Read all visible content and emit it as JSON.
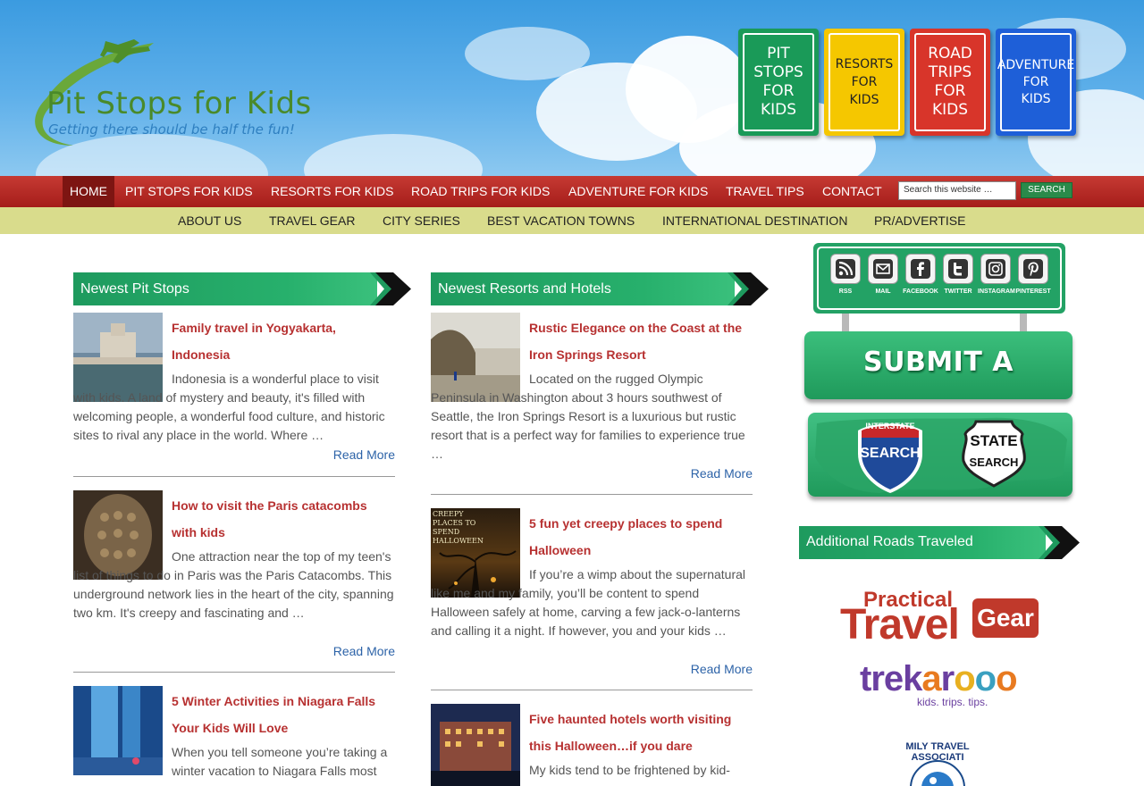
{
  "header": {
    "logo_title": "Pit Stops for Kids",
    "logo_tagline": "Getting there should be half the fun!",
    "signs": [
      {
        "label": "PIT\nSTOPS\nFOR\nKIDS",
        "bg": "#1a9a58",
        "fg": "#ffffff"
      },
      {
        "label": "RESORTS\nFOR\nKIDS",
        "bg": "#f5c700",
        "fg": "#222222"
      },
      {
        "label": "ROAD\nTRIPS\nFOR\nKIDS",
        "bg": "#d8352a",
        "fg": "#ffffff"
      },
      {
        "label": "ADVENTURE\nFOR\nKIDS",
        "bg": "#1e5fd8",
        "fg": "#ffffff"
      }
    ]
  },
  "nav_primary": {
    "items": [
      "HOME",
      "PIT STOPS FOR KIDS",
      "RESORTS FOR KIDS",
      "ROAD TRIPS FOR KIDS",
      "ADVENTURE FOR KIDS",
      "TRAVEL TIPS",
      "CONTACT"
    ],
    "search_placeholder": "Search this website …",
    "search_button": "SEARCH"
  },
  "nav_secondary": {
    "items": [
      "ABOUT US",
      "TRAVEL GEAR",
      "CITY SERIES",
      "BEST VACATION TOWNS",
      "INTERNATIONAL DESTINATION",
      "PR/ADVERTISE"
    ]
  },
  "pitstops": {
    "heading": "Newest Pit Stops",
    "posts": [
      {
        "title": "Family travel in Yogyakarta, Indonesia",
        "excerpt": "Indonesia is a wonderful place to visit with kids. A land of mystery and beauty, it's filled with welcoming people, a wonderful food culture, and historic sites to rival any place in the world. Where …",
        "more": "Read More"
      },
      {
        "title": "How to visit the Paris catacombs with kids",
        "excerpt": "One attraction near the top of my teen's list of things to do in Paris was the Paris Catacombs. This underground network lies in the heart of the city, spanning two km. It's creepy and fascinating and …",
        "more": "Read More"
      },
      {
        "title": "5 Winter Activities in Niagara Falls Your Kids Will Love",
        "excerpt": "When you tell someone you’re taking a winter vacation to Niagara Falls most",
        "more": ""
      }
    ]
  },
  "resorts": {
    "heading": "Newest Resorts and Hotels",
    "posts": [
      {
        "title": "Rustic Elegance on the Coast at the Iron Springs Resort",
        "excerpt": "Located on the rugged Olympic Peninsula in Washington about 3 hours southwest of Seattle, the Iron Springs Resort is a luxurious but rustic resort that is a perfect way for families to experience true …",
        "more": "Read More"
      },
      {
        "title": "5 fun yet creepy places to spend Halloween",
        "excerpt": "If you’re a wimp about the supernatural like me and my family, you’ll be content to spend Halloween safely at home, carving a few jack-o-lanterns and calling it a night. If however, you and your kids …",
        "more": "Read More",
        "thumb_text": "CREEPY PLACES TO SPEND HALLOWEEN"
      },
      {
        "title": "Five haunted hotels worth visiting this Halloween…if you dare",
        "excerpt": "My kids tend to be frightened by kid-",
        "more": ""
      }
    ]
  },
  "sidebar": {
    "social": [
      {
        "label": "RSS",
        "icon": "rss-icon"
      },
      {
        "label": "MAIL",
        "icon": "mail-icon"
      },
      {
        "label": "FACEBOOK",
        "icon": "facebook-icon"
      },
      {
        "label": "TWITTER",
        "icon": "twitter-icon"
      },
      {
        "label": "INSTAGRAM",
        "icon": "instagram-icon"
      },
      {
        "label": "PINTEREST",
        "icon": "pinterest-icon"
      }
    ],
    "submit_review": "SUBMIT A REVIEW",
    "interstate_top": "INTERSTATE",
    "interstate_search": "SEARCH",
    "state_search_1": "STATE",
    "state_search_2": "SEARCH",
    "roads_heading": "Additional Roads Traveled",
    "ptg_practical": "Practical",
    "ptg_travel": "Travel",
    "ptg_gear": "Gear",
    "trekaroo_tagline": "kids. trips. tips.",
    "fta_text": "MILY TRAVEL ASSOCIATI"
  }
}
